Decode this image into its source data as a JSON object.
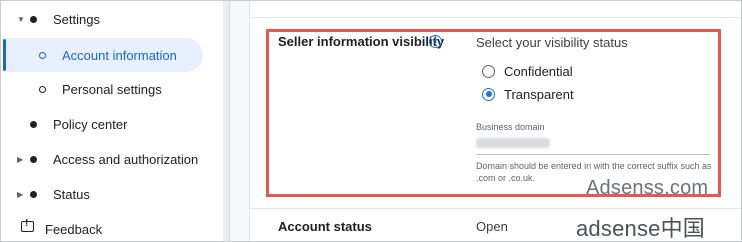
{
  "sidebar": {
    "items": [
      {
        "label": "Settings",
        "level": 0,
        "expanded": true,
        "selected": false
      },
      {
        "label": "Account information",
        "level": 1,
        "selected": true
      },
      {
        "label": "Personal settings",
        "level": 1,
        "selected": false
      },
      {
        "label": "Policy center",
        "level": 0,
        "selected": false
      },
      {
        "label": "Access and authorization",
        "level": 0,
        "expanded": false,
        "selected": false
      },
      {
        "label": "Status",
        "level": 0,
        "expanded": false,
        "selected": false
      },
      {
        "label": "Feedback",
        "level": 0,
        "icon": "feedback-icon",
        "selected": false
      }
    ]
  },
  "main": {
    "seller_section": {
      "title": "Seller information visibility",
      "info_icon": "info-icon",
      "status_prompt": "Select your visibility status",
      "options": [
        {
          "label": "Confidential",
          "checked": false
        },
        {
          "label": "Transparent",
          "checked": true
        }
      ],
      "business_domain_label": "Business domain",
      "helper_text": "Domain should be entered in with the correct suffix such as .com or .co.uk."
    },
    "account_status": {
      "label": "Account status",
      "value": "Open"
    }
  },
  "watermarks": {
    "line1": "Adsenss.com",
    "line2": "adsense中国"
  },
  "colors": {
    "accent": "#1a73e8",
    "selected_bg": "#e8f0fe",
    "highlight_border": "#e8584f"
  }
}
